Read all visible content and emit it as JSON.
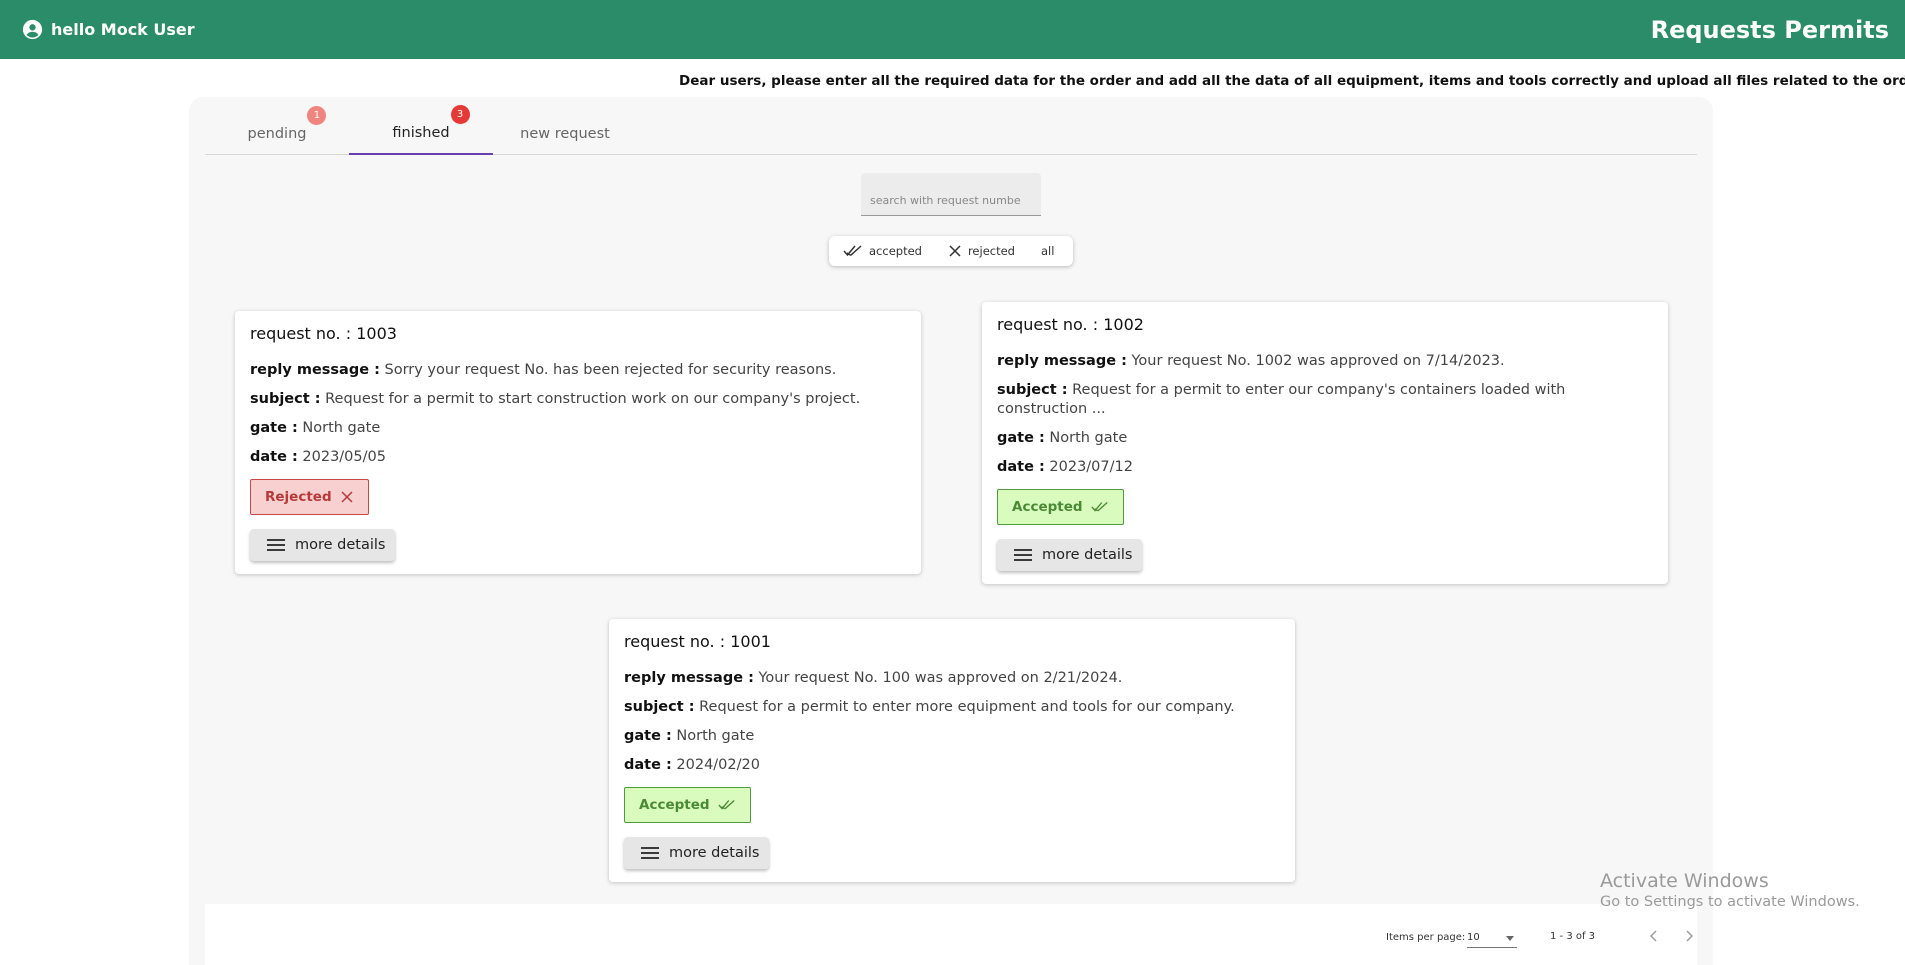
{
  "header": {
    "greeting": "hello Mock User",
    "title": "Requests Permits"
  },
  "notice": "Dear users, please enter all the required data for the order and add all the data of all equipment, items and tools correctly and upload all files related to the order, if any. Than",
  "tabs": [
    {
      "label": "pending",
      "badge": "1"
    },
    {
      "label": "finished",
      "badge": "3"
    },
    {
      "label": "new request"
    }
  ],
  "search": {
    "placeholder": "search with request numbe",
    "value": ""
  },
  "filters": {
    "accepted": "accepted",
    "rejected": "rejected",
    "all": "all"
  },
  "labels": {
    "request_no": "request no. :",
    "reply_message": "reply message :",
    "subject": "subject :",
    "gate": "gate :",
    "date": "date :",
    "more_details": "more details"
  },
  "requests": [
    {
      "number": "1003",
      "reply": "Sorry your request No. has been rejected for security reasons.",
      "subject": "Request for a permit to start construction work on our company's project.",
      "gate": "North gate",
      "date": "2023/05/05",
      "status": "Rejected"
    },
    {
      "number": "1002",
      "reply": "Your request No. 1002 was approved on 7/14/2023.",
      "subject": "Request for a permit to enter our company's containers loaded with construction ...",
      "gate": "North gate",
      "date": "2023/07/12",
      "status": "Accepted"
    },
    {
      "number": "1001",
      "reply": "Your request No. 100 was approved on 2/21/2024.",
      "subject": "Request for a permit to enter more equipment and tools for our company.",
      "gate": "North gate",
      "date": "2024/02/20",
      "status": "Accepted"
    }
  ],
  "paginator": {
    "items_per_page_label": "Items per page:",
    "items_per_page": "10",
    "range": "1 - 3 of 3"
  },
  "watermark": {
    "line1": "Activate Windows",
    "line2": "Go to Settings to activate Windows."
  },
  "colors": {
    "header": "#2b8c69",
    "tab_indicator": "#6a3fb0",
    "rejected": "#c64848",
    "accepted": "#4f9a3a"
  }
}
